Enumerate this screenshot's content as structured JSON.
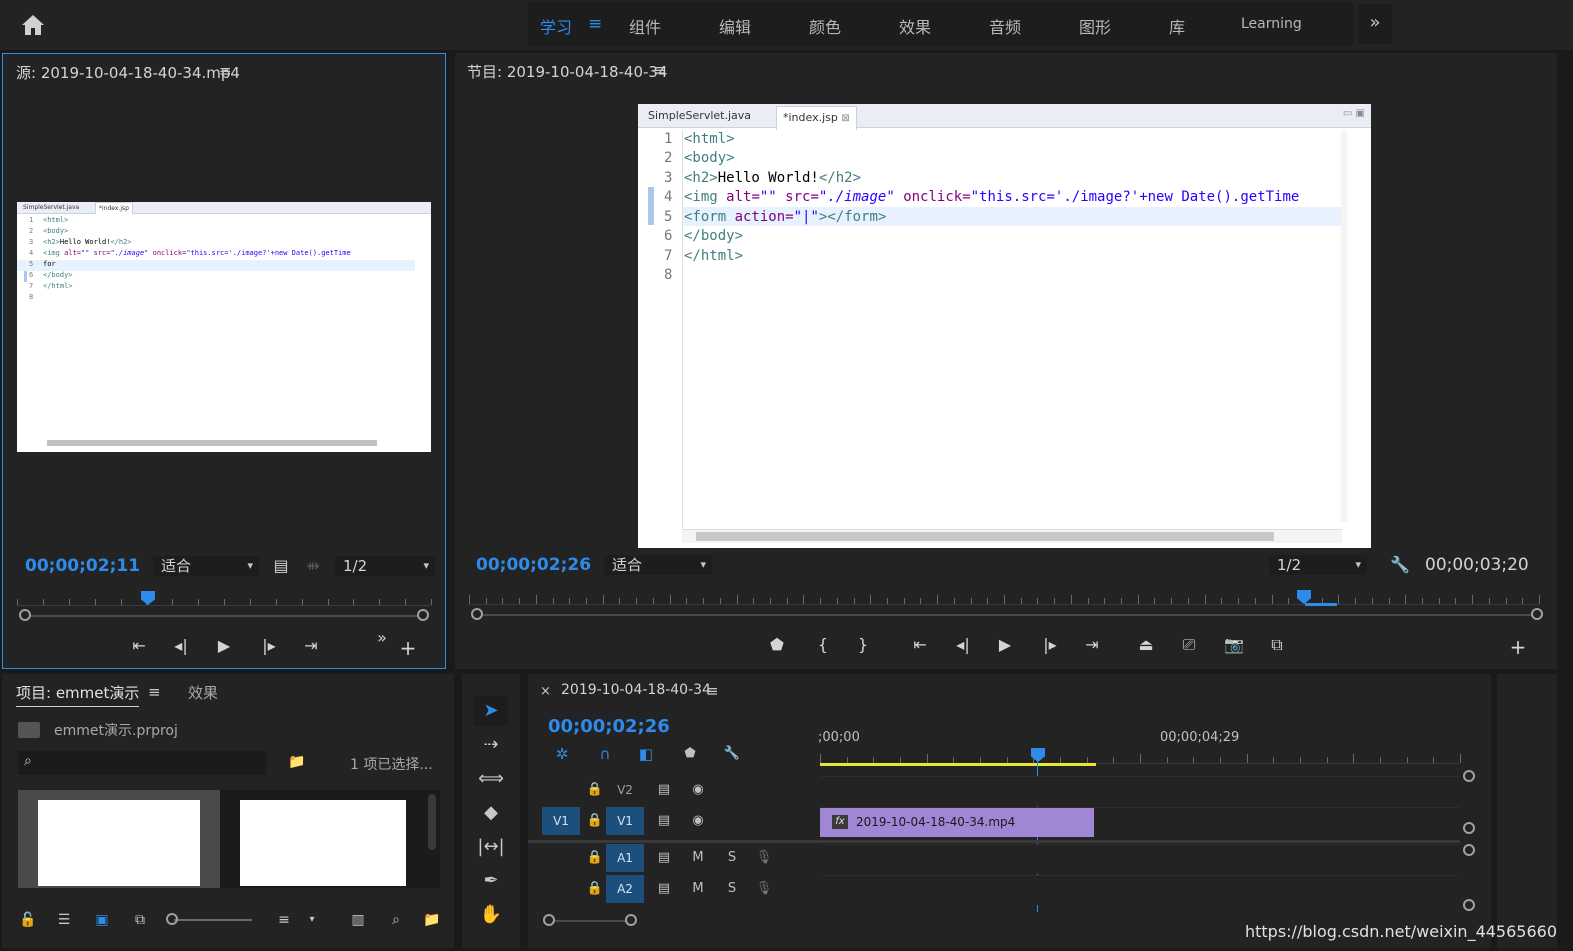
{
  "workspaces": {
    "tabs": [
      "学习",
      "组件",
      "编辑",
      "颜色",
      "效果",
      "音频",
      "图形",
      "库",
      "Learning"
    ],
    "active_index": 0,
    "more_label": "»"
  },
  "source_panel": {
    "title": "源: 2019-10-04-18-40-34.mp4",
    "timecode": "00;00;02;11",
    "fit_label": "适合",
    "resolution": "1/2",
    "more_label": "»"
  },
  "program_panel": {
    "title": "节目: 2019-10-04-18-40-34",
    "timecode": "00;00;02;26",
    "fit_label": "适合",
    "resolution": "1/2",
    "duration": "00;00;03;20"
  },
  "editor": {
    "tabs": [
      "SimpleServlet.java",
      "*index.jsp"
    ],
    "line_numbers": [
      "1",
      "2",
      "3",
      "4",
      "5",
      "6",
      "7",
      "8"
    ],
    "source_lines": {
      "l1_tag": "<html>",
      "l2_tag": "<body>",
      "l3_open": "<h2>",
      "l3_text": "Hello World!",
      "l3_close": "</h2>",
      "l4_open": "<img ",
      "l4_attr1": "alt=",
      "l4_val1": "\"\" ",
      "l4_attr2": "src=",
      "l4_val2": "\"./image\" ",
      "l4_attr3": "onclick=",
      "l4_val3": "\"this.src='./image?'+new Date().getTime",
      "l5_typed": "for",
      "l6_tag": "</body>",
      "l7_tag": "</html>"
    },
    "program_lines": {
      "l5_open": "<form ",
      "l5_attr": "action=",
      "l5_val": "\"|\"",
      "l5_close": "></form>"
    }
  },
  "project_panel": {
    "tab_project": "项目: emmet演示",
    "tab_effects": "效果",
    "project_file": "emmet演示.prproj",
    "search_placeholder": "",
    "selection_status": "1 项已选择..."
  },
  "timeline": {
    "sequence_name": "2019-10-04-18-40-34",
    "timecode": "00;00;02;26",
    "ruler_labels": [
      ";00;00",
      "00;00;04;29"
    ],
    "tracks": [
      {
        "id": "V2",
        "target": "",
        "icons": [
          "lock-icon",
          "film-icon",
          "eye-icon"
        ]
      },
      {
        "id": "V1",
        "target": "V1",
        "icons": [
          "lock-icon",
          "film-icon",
          "eye-icon"
        ]
      },
      {
        "id": "A1",
        "target": "",
        "labels": [
          "M",
          "S"
        ]
      },
      {
        "id": "A2",
        "target": "",
        "labels": [
          "M",
          "S"
        ]
      }
    ],
    "clip_name": "2019-10-04-18-40-34.mp4",
    "mute_label": "M",
    "solo_label": "S"
  },
  "watermark": "https://blog.csdn.net/weixin_44565660",
  "colors": {
    "accent": "#2d8ceb",
    "panel_bg": "#232323",
    "clip_video": "#a286d6",
    "track_target": "#1c4f7c",
    "work_area": "#e8e832"
  }
}
